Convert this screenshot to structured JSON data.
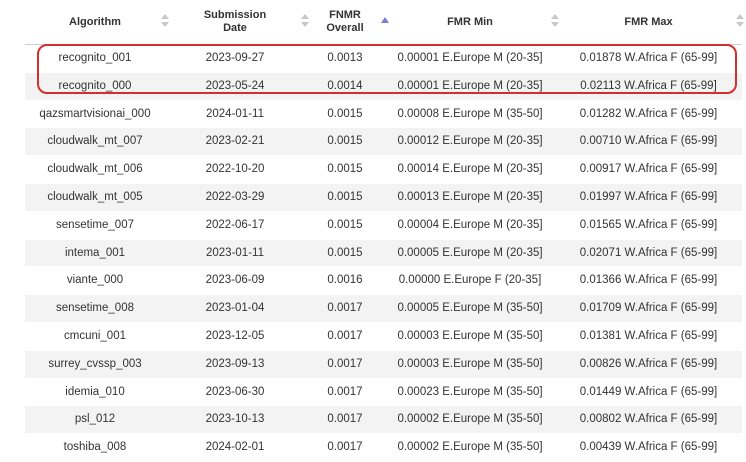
{
  "columns": [
    {
      "label": "Algorithm"
    },
    {
      "label": "Submission Date"
    },
    {
      "label": "FNMR Overall"
    },
    {
      "label": "FMR Min"
    },
    {
      "label": "FMR Max"
    }
  ],
  "colors": {
    "highlight": "#d32f2f",
    "sort_active": "#7a7fd6"
  },
  "rows": [
    {
      "algorithm": "recognito_001",
      "date": "2023-09-27",
      "fnmr": "0.0013",
      "fmr_min": "0.00001 E.Europe M (20-35]",
      "fmr_max": "0.01878 W.Africa F (65-99]"
    },
    {
      "algorithm": "recognito_000",
      "date": "2023-05-24",
      "fnmr": "0.0014",
      "fmr_min": "0.00001 E.Europe M (20-35]",
      "fmr_max": "0.02113 W.Africa F (65-99]"
    },
    {
      "algorithm": "qazsmartvisionai_000",
      "date": "2024-01-11",
      "fnmr": "0.0015",
      "fmr_min": "0.00008 E.Europe M (35-50]",
      "fmr_max": "0.01282 W.Africa F (65-99]"
    },
    {
      "algorithm": "cloudwalk_mt_007",
      "date": "2023-02-21",
      "fnmr": "0.0015",
      "fmr_min": "0.00012 E.Europe M (20-35]",
      "fmr_max": "0.00710 W.Africa F (65-99]"
    },
    {
      "algorithm": "cloudwalk_mt_006",
      "date": "2022-10-20",
      "fnmr": "0.0015",
      "fmr_min": "0.00014 E.Europe M (20-35]",
      "fmr_max": "0.00917 W.Africa F (65-99]"
    },
    {
      "algorithm": "cloudwalk_mt_005",
      "date": "2022-03-29",
      "fnmr": "0.0015",
      "fmr_min": "0.00013 E.Europe M (20-35]",
      "fmr_max": "0.01997 W.Africa F (65-99]"
    },
    {
      "algorithm": "sensetime_007",
      "date": "2022-06-17",
      "fnmr": "0.0015",
      "fmr_min": "0.00004 E.Europe M (20-35]",
      "fmr_max": "0.01565 W.Africa F (65-99]"
    },
    {
      "algorithm": "intema_001",
      "date": "2023-01-11",
      "fnmr": "0.0015",
      "fmr_min": "0.00005 E.Europe M (20-35]",
      "fmr_max": "0.02071 W.Africa F (65-99]"
    },
    {
      "algorithm": "viante_000",
      "date": "2023-06-09",
      "fnmr": "0.0016",
      "fmr_min": "0.00000 E.Europe F (20-35]",
      "fmr_max": "0.01366 W.Africa F (65-99]"
    },
    {
      "algorithm": "sensetime_008",
      "date": "2023-01-04",
      "fnmr": "0.0017",
      "fmr_min": "0.00005 E.Europe M (35-50]",
      "fmr_max": "0.01709 W.Africa F (65-99]"
    },
    {
      "algorithm": "cmcuni_001",
      "date": "2023-12-05",
      "fnmr": "0.0017",
      "fmr_min": "0.00003 E.Europe M (35-50]",
      "fmr_max": "0.01381 W.Africa F (65-99]"
    },
    {
      "algorithm": "surrey_cvssp_003",
      "date": "2023-09-13",
      "fnmr": "0.0017",
      "fmr_min": "0.00003 E.Europe M (35-50]",
      "fmr_max": "0.00826 W.Africa F (65-99]"
    },
    {
      "algorithm": "idemia_010",
      "date": "2023-06-30",
      "fnmr": "0.0017",
      "fmr_min": "0.00023 E.Europe M (35-50]",
      "fmr_max": "0.01449 W.Africa F (65-99]"
    },
    {
      "algorithm": "psl_012",
      "date": "2023-10-13",
      "fnmr": "0.0017",
      "fmr_min": "0.00002 E.Europe M (35-50]",
      "fmr_max": "0.00802 W.Africa F (65-99]"
    },
    {
      "algorithm": "toshiba_008",
      "date": "2024-02-01",
      "fnmr": "0.0017",
      "fmr_min": "0.00002 E.Europe M (35-50]",
      "fmr_max": "0.00439 W.Africa F (65-99]"
    }
  ]
}
